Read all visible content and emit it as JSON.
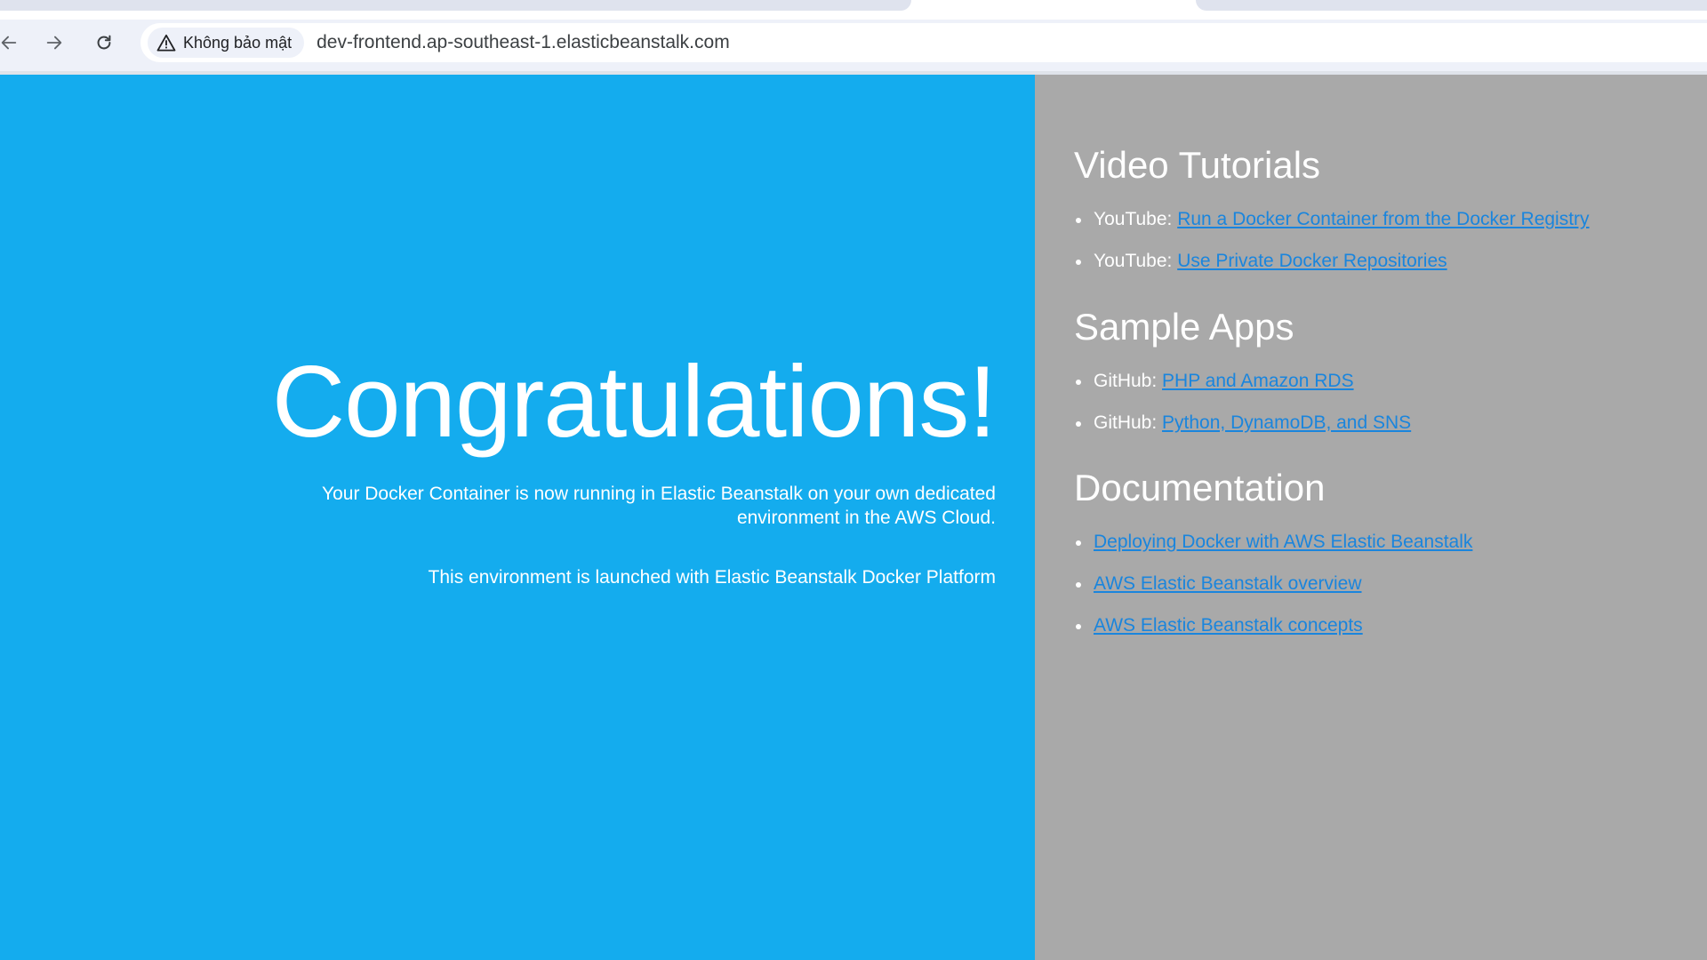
{
  "browser": {
    "url": "dev-frontend.ap-southeast-1.elasticbeanstalk.com",
    "security_label": "Không bảo mật",
    "icons": [
      "back-arrow-icon",
      "forward-arrow-icon",
      "reload-icon",
      "warning-triangle-icon"
    ]
  },
  "hero": {
    "title": "Congratulations!",
    "message": "Your Docker Container is now running in Elastic Beanstalk on your own dedicated environment in the AWS Cloud.",
    "platform_note": "This environment is launched with Elastic Beanstalk Docker Platform"
  },
  "sidebar": {
    "video_tutorials": {
      "heading": "Video Tutorials",
      "items": [
        {
          "prefix": "YouTube: ",
          "link": "Run a Docker Container from the Docker Registry"
        },
        {
          "prefix": "YouTube: ",
          "link": "Use Private Docker Repositories"
        }
      ]
    },
    "sample_apps": {
      "heading": "Sample Apps",
      "items": [
        {
          "prefix": "GitHub: ",
          "link": "PHP and Amazon RDS"
        },
        {
          "prefix": "GitHub: ",
          "link": "Python, DynamoDB, and SNS"
        }
      ]
    },
    "documentation": {
      "heading": "Documentation",
      "items": [
        {
          "link": "Deploying Docker with AWS Elastic Beanstalk"
        },
        {
          "link": "AWS Elastic Beanstalk overview"
        },
        {
          "link": "AWS Elastic Beanstalk concepts"
        }
      ]
    }
  },
  "colors": {
    "hero_background": "#14acee",
    "sidebar_background": "#a9a9a9",
    "link": "#1a85dd",
    "text_on_panels": "#ffffff"
  }
}
